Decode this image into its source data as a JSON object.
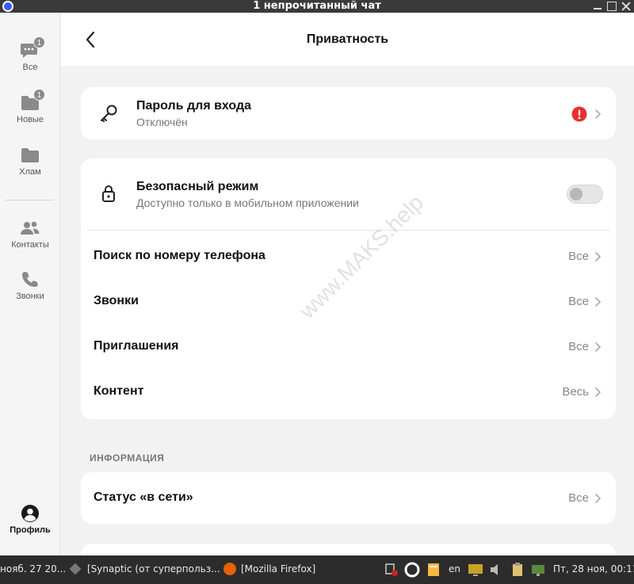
{
  "window": {
    "title": "1 непрочитанный чат"
  },
  "sidebar": {
    "items": [
      {
        "label": "Все",
        "badge": "1",
        "icon": "chat-icon"
      },
      {
        "label": "Новые",
        "badge": "1",
        "icon": "folder-icon"
      },
      {
        "label": "Хлам",
        "icon": "folder-icon"
      },
      {
        "label": "Контакты",
        "icon": "contacts-icon"
      },
      {
        "label": "Звонки",
        "icon": "phone-icon"
      }
    ],
    "profile": {
      "label": "Профиль",
      "icon": "profile-icon"
    }
  },
  "header": {
    "title": "Приватность",
    "back_icon": "chevron-left-icon"
  },
  "login_password": {
    "title": "Пароль для входа",
    "subtitle": "Отключён",
    "icon": "key-icon",
    "warning_icon": "alert-icon",
    "warning_color": "#e8312f"
  },
  "safe_mode": {
    "title": "Безопасный режим",
    "subtitle": "Доступно только в мобильном приложении",
    "icon": "lock-icon",
    "enabled": false
  },
  "privacy_rows": [
    {
      "label": "Поиск по номеру телефона",
      "value": "Все"
    },
    {
      "label": "Звонки",
      "value": "Все"
    },
    {
      "label": "Приглашения",
      "value": "Все"
    },
    {
      "label": "Контент",
      "value": "Весь"
    }
  ],
  "info_section": {
    "label": "ИНФОРМАЦИЯ",
    "rows": [
      {
        "label": "Статус «в сети»",
        "value": "Все"
      }
    ]
  },
  "watermark": "www.MAKS.help",
  "taskbar": {
    "items": [
      {
        "label": "нояб. 27 20..."
      },
      {
        "label": "[Synaptic (от суперпольз..."
      },
      {
        "label": "[Mozilla Firefox]"
      }
    ],
    "lang": "en",
    "clock": "Пт, 28 ноя, 00:11"
  }
}
